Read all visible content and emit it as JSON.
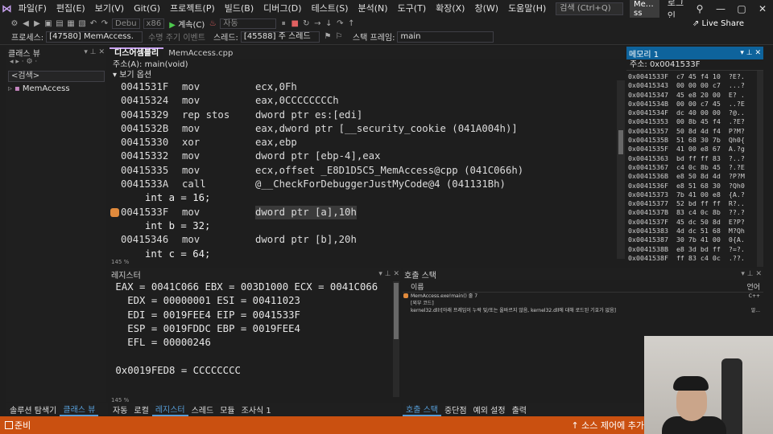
{
  "menubar": {
    "logo": "⋈",
    "items": [
      "파일(F)",
      "편집(E)",
      "보기(V)",
      "Git(G)",
      "프로젝트(P)",
      "빌드(B)",
      "디버그(D)",
      "테스트(S)",
      "분석(N)",
      "도구(T)",
      "확장(X)",
      "창(W)",
      "도움말(H)"
    ],
    "search": "검색 (Ctrl+Q)",
    "solution_name": "Me…ss",
    "login": "로그인"
  },
  "toolbar": {
    "config": "Debu",
    "platform": "x86",
    "continue_label": "계속(C)",
    "auto_label": "자동",
    "live_share": "Live Share"
  },
  "process_bar": {
    "process_label": "프로세스:",
    "process_value": "[47580] MemAccess.",
    "lifecycle_label": "수명 주기 이벤트",
    "thread_label": "스레드:",
    "thread_value": "[45588] 주 스레드",
    "stackframe_label": "스택 프레임:",
    "stackframe_value": "main"
  },
  "class_view": {
    "title": "클래스 뷰",
    "search_placeholder": "<검색>",
    "tree_item": "MemAccess"
  },
  "disassembly": {
    "tab_active": "디스어셈블리",
    "tab_inactive": "MemAccess.cpp",
    "address_label": "주소(A): main(void)",
    "options_label": "보기 옵션",
    "lines": [
      {
        "addr": "0041531F",
        "op": "mov",
        "args": "ecx,0Fh"
      },
      {
        "addr": "00415324",
        "op": "mov",
        "args": "eax,0CCCCCCCCh"
      },
      {
        "addr": "00415329",
        "op": "rep stos",
        "args": "dword ptr es:[edi]"
      },
      {
        "addr": "0041532B",
        "op": "mov",
        "args": "eax,dword ptr [__security_cookie (041A004h)]"
      },
      {
        "addr": "00415330",
        "op": "xor",
        "args": "eax,ebp"
      },
      {
        "addr": "00415332",
        "op": "mov",
        "args": "dword ptr [ebp-4],eax"
      },
      {
        "addr": "00415335",
        "op": "mov",
        "args": "ecx,offset _E8D1D5C5_MemAccess@cpp (041C066h)"
      },
      {
        "addr": "0041533A",
        "op": "call",
        "args": "@__CheckForDebuggerJustMyCode@4 (041131Bh)"
      },
      {
        "src": "int a = 16;"
      },
      {
        "addr": "0041533F",
        "op": "mov",
        "args": "dword ptr [a],10h",
        "current": true
      },
      {
        "src": "int b = 32;"
      },
      {
        "addr": "00415346",
        "op": "mov",
        "args": "dword ptr [b],20h"
      },
      {
        "src": "int c = 64;"
      }
    ],
    "zoom": "145 %"
  },
  "memory": {
    "title": "메모리 1",
    "address_label": "주소: 0x0041533F",
    "rows": [
      "0x0041533F  c7 45 f4 10  ?E?.",
      "0x00415343  00 00 00 c7  ...?",
      "0x00415347  45 e8 20 00  E? .",
      "0x0041534B  00 00 c7 45  ..?E",
      "0x0041534F  dc 40 00 00  ?@..",
      "0x00415353  00 8b 45 f4  .?E?",
      "0x00415357  50 8d 4d f4  P?M?",
      "0x0041535B  51 68 30 7b  Qh0{",
      "0x0041535F  41 00 e8 67  A.?g",
      "0x00415363  bd ff ff 83  ?..?",
      "0x00415367  c4 0c 8b 45  ?.?E",
      "0x0041536B  e8 50 8d 4d  ?P?M",
      "0x0041536F  e8 51 68 30  ?Qh0",
      "0x00415373  7b 41 00 e8  {A.?",
      "0x00415377  52 bd ff ff  R?..",
      "0x0041537B  83 c4 0c 8b  ??.?",
      "0x0041537F  45 dc 50 8d  E?P?",
      "0x00415383  4d dc 51 68  M?Qh",
      "0x00415387  30 7b 41 00  0{A.",
      "0x0041538B  e8 3d bd ff  ?=?.",
      "0x0041538F  ff 83 c4 0c  .??."
    ]
  },
  "registers": {
    "title": "레지스터",
    "lines": [
      " EAX = 0041C066 EBX = 003D1000 ECX = 0041C066",
      "   EDX = 00000001 ESI = 00411023",
      "   EDI = 0019FEE4 EIP = 0041533F",
      "   ESP = 0019FDDC EBP = 0019FEE4",
      "   EFL = 00000246",
      "",
      " 0x0019FED8 = CCCCCCCC"
    ],
    "zoom": "145 %"
  },
  "callstack": {
    "title": "호출 스택",
    "col_name": "이름",
    "col_lang": "언어",
    "rows": [
      {
        "name": "MemAccess.exe!main() 줄 7",
        "lang": "C++",
        "current": true
      },
      {
        "name": "[외부 코드]",
        "lang": ""
      },
      {
        "name": "kernel32.dll![아래 프레임이 누락 및/또는 올바르지 않음, kernel32.dll에 대해 로드된 기호가 없음]",
        "lang": "알..."
      }
    ]
  },
  "bottom_tabs_left": [
    "솔루션 탐색기",
    "클래스 뷰"
  ],
  "bottom_tabs_mid": [
    "자동",
    "로컬",
    "레지스터",
    "스레드",
    "모듈",
    "조사식 1"
  ],
  "bottom_tabs_right": [
    "호출 스택",
    "중단점",
    "예외 설정",
    "출력"
  ],
  "statusbar": {
    "ready": "준비",
    "source_control": "↑ 소스 제어에 추가"
  }
}
